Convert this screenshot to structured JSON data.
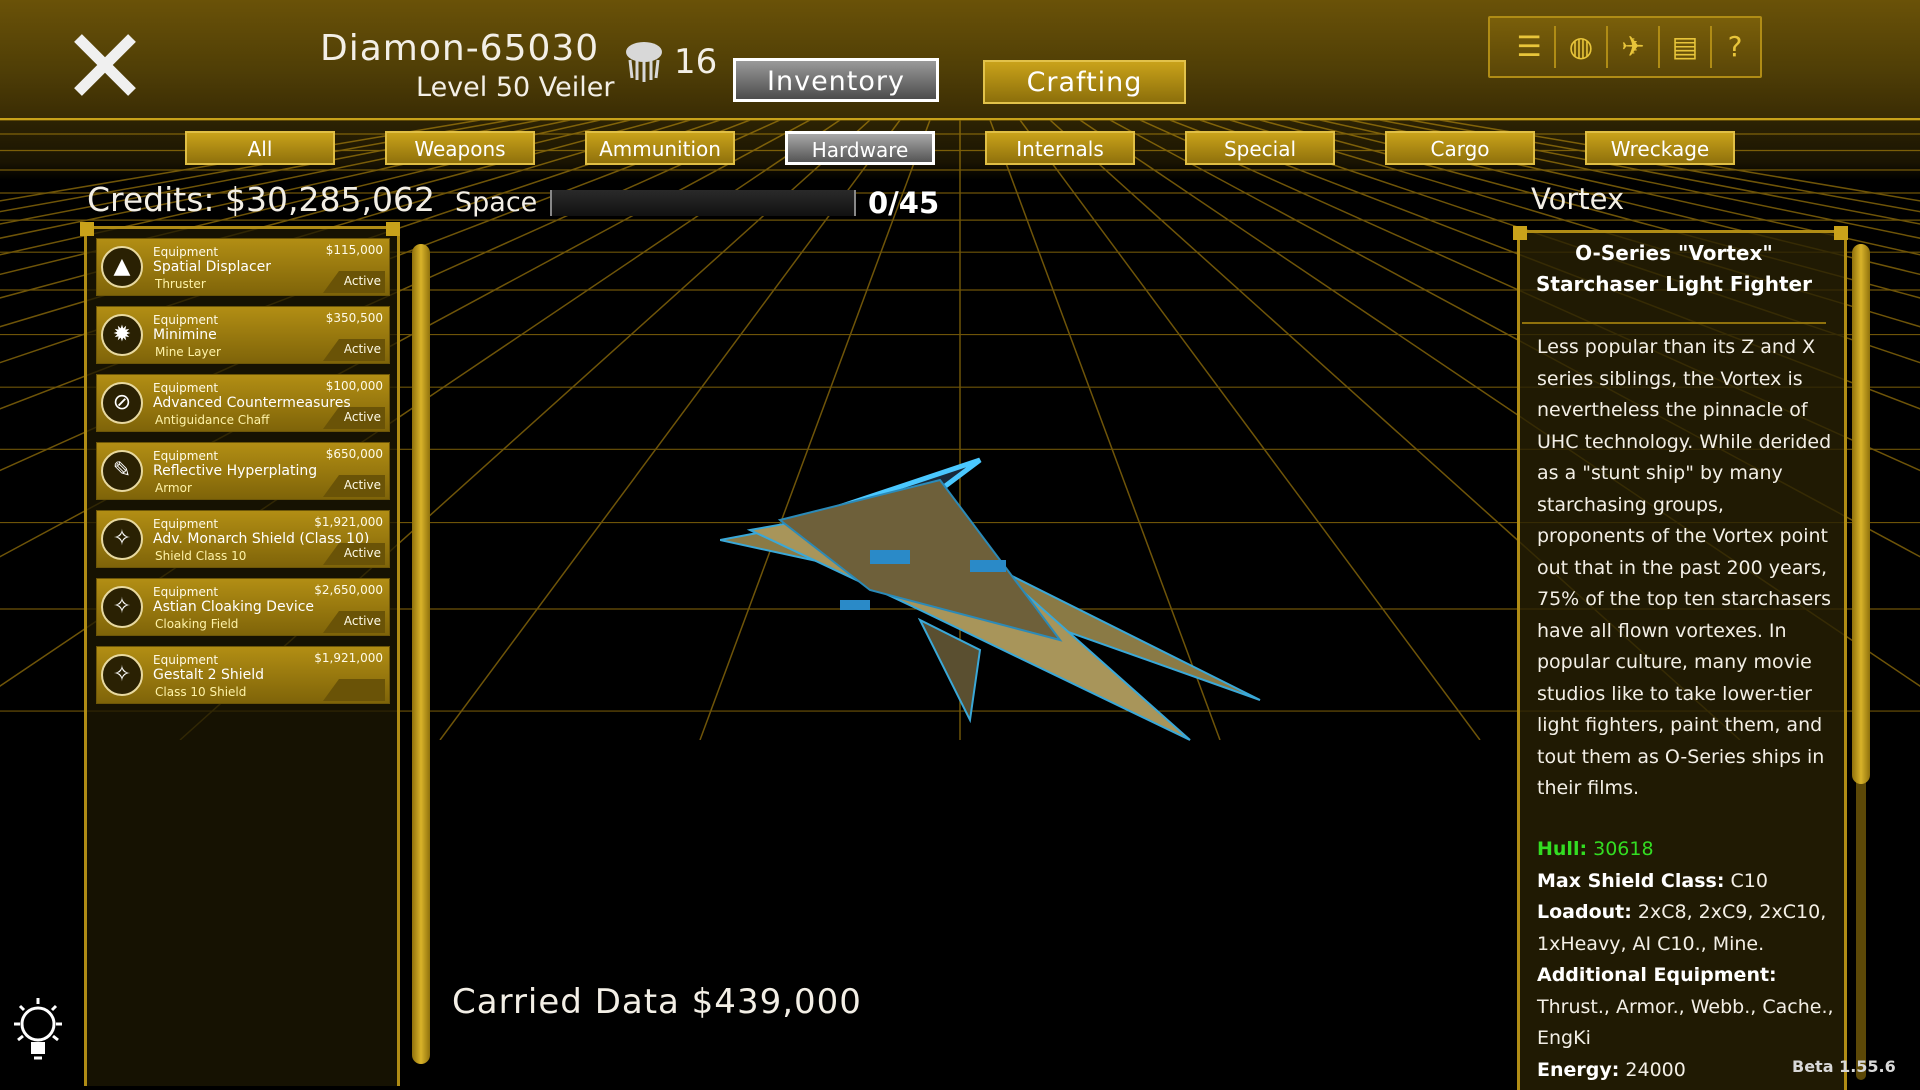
{
  "header": {
    "player_name": "Diamon-65030",
    "player_level": "Level 50 Veiler",
    "token_count": "16",
    "buttons": {
      "inventory": "Inventory",
      "crafting": "Crafting"
    },
    "tray_icons": [
      "list-icon",
      "globe-icon",
      "map-icon",
      "notebook-icon",
      "help-icon"
    ]
  },
  "tabs": [
    "All",
    "Weapons",
    "Ammunition",
    "Hardware",
    "Internals",
    "Special",
    "Cargo",
    "Wreckage"
  ],
  "active_tab": "Hardware",
  "credits": "Credits: $30,285,062",
  "space": {
    "label": "Space",
    "value": "0/45",
    "fraction": 0
  },
  "ship_name": "Vortex",
  "items": [
    {
      "category": "Equipment",
      "price": "$115,000",
      "name": "Spatial Displacer",
      "sub": "Thruster",
      "status": "Active",
      "icon": "thruster-icon"
    },
    {
      "category": "Equipment",
      "price": "$350,500",
      "name": "Minimine",
      "sub": "Mine Layer",
      "status": "Active",
      "icon": "mine-icon"
    },
    {
      "category": "Equipment",
      "price": "$100,000",
      "name": "Advanced Countermeasures",
      "sub": "Antiguidance Chaff",
      "status": "Active",
      "icon": "countermeasure-icon"
    },
    {
      "category": "Equipment",
      "price": "$650,000",
      "name": "Reflective Hyperplating",
      "sub": "Armor",
      "status": "Active",
      "icon": "wrench-icon"
    },
    {
      "category": "Equipment",
      "price": "$1,921,000",
      "name": "Adv. Monarch Shield (Class 10)",
      "sub": "Shield Class 10",
      "status": "Active",
      "icon": "shield-icon"
    },
    {
      "category": "Equipment",
      "price": "$2,650,000",
      "name": "Astian Cloaking Device",
      "sub": "Cloaking Field",
      "status": "Active",
      "icon": "cloak-icon"
    },
    {
      "category": "Equipment",
      "price": "$1,921,000",
      "name": "Gestalt 2 Shield",
      "sub": "Class 10 Shield",
      "status": "",
      "icon": "shield-icon"
    }
  ],
  "carried_data": "Carried Data  $439,000",
  "detail": {
    "title_line1": "O-Series \"Vortex\"",
    "title_line2": "Starchaser Light Fighter",
    "description": "Less popular than its Z and X series siblings, the Vortex is nevertheless the pinnacle of UHC technology. While derided as a \"stunt ship\" by many starchasing groups, proponents of the Vortex point out that in the past 200 years, 75% of the top ten starchasers have all flown vortexes. In popular culture, many movie studios like to take lower-tier light fighters, paint them, and tout them as O-Series ships in their films.",
    "hull_label": "Hull:",
    "hull_value": "30618",
    "max_shield_label": "Max Shield Class:",
    "max_shield_value": "C10",
    "loadout_label": "Loadout:",
    "loadout_value": "2xC8, 2xC9, 2xC10, 1xHeavy, AI C10., Mine.",
    "additional_label": "Additional Equipment:",
    "additional_value": "Thrust., Armor., Webb., Cache., EngKi",
    "energy_label": "Energy:",
    "energy_value": "24000"
  },
  "version": "Beta 1.55.6",
  "colors": {
    "gold": "#c9a21a",
    "hull_green": "#33dd22"
  }
}
